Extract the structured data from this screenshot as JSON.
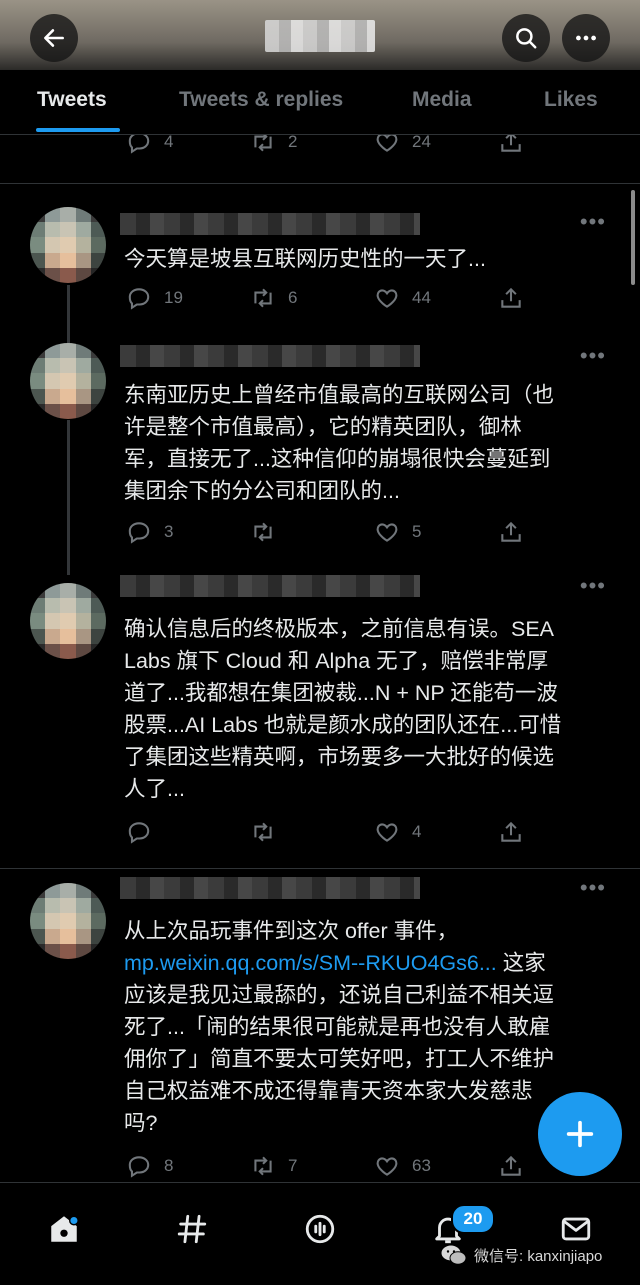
{
  "header": {
    "back_icon": "arrow-left-icon",
    "search_icon": "search-icon",
    "more_icon": "more-horizontal-icon"
  },
  "tabs": [
    {
      "label": "Tweets",
      "active": true
    },
    {
      "label": "Tweets & replies",
      "active": false
    },
    {
      "label": "Media",
      "active": false
    },
    {
      "label": "Likes",
      "active": false
    }
  ],
  "top_partial_actions": {
    "replies": "4",
    "retweets": "2",
    "likes": "24"
  },
  "tweets": [
    {
      "text": "今天算是坡县互联网历史性的一天了...",
      "replies": "19",
      "retweets": "6",
      "likes": "44"
    },
    {
      "lines": [
        "东南亚历史上曾经市值最高的互联网公司（也",
        "许是整个市值最高），它的精英团队，御林",
        "军，直接无了...这种信仰的崩塌很快会蔓延到",
        "集团余下的分公司和团队的..."
      ],
      "replies": "3",
      "retweets": "",
      "likes": "5"
    },
    {
      "lines": [
        "确认信息后的终极版本，之前信息有误。SEA",
        "Labs 旗下 Cloud 和 Alpha 无了，赔偿非常厚",
        "道了...我都想在集团被裁...N + NP 还能苟一波",
        "股票...AI Labs 也就是颜水成的团队还在...可惜",
        "了集团这些精英啊，市场要多一大批好的候选",
        "人了..."
      ],
      "replies": "",
      "retweets": "",
      "likes": "4"
    },
    {
      "line1": "从上次品玩事件到这次 offer 事件，",
      "link": "mp.weixin.qq.com/s/SM--RKUO4Gs6...",
      "after_link": " 这家",
      "lines": [
        "应该是我见过最舔的，还说自己利益不相关逗",
        "死了...「闹的结果很可能就是再也没有人敢雇",
        "佣你了」简直不要太可笑好吧，打工人不维护",
        "自己权益难不成还得靠青天资本家大发慈悲",
        "吗?"
      ],
      "replies": "8",
      "retweets": "7",
      "likes": "63"
    }
  ],
  "compose_icon": "plus-icon",
  "bottom_nav": {
    "home_icon": "home-icon",
    "explore_icon": "hashtag-icon",
    "spaces_icon": "spaces-icon",
    "notifications_icon": "bell-icon",
    "notifications_badge": "20",
    "messages_icon": "mail-icon"
  },
  "watermark": {
    "text": "微信号: kanxinjiapo"
  },
  "colors": {
    "accent": "#1d9bf0",
    "background": "#000000",
    "muted": "#71767b"
  }
}
